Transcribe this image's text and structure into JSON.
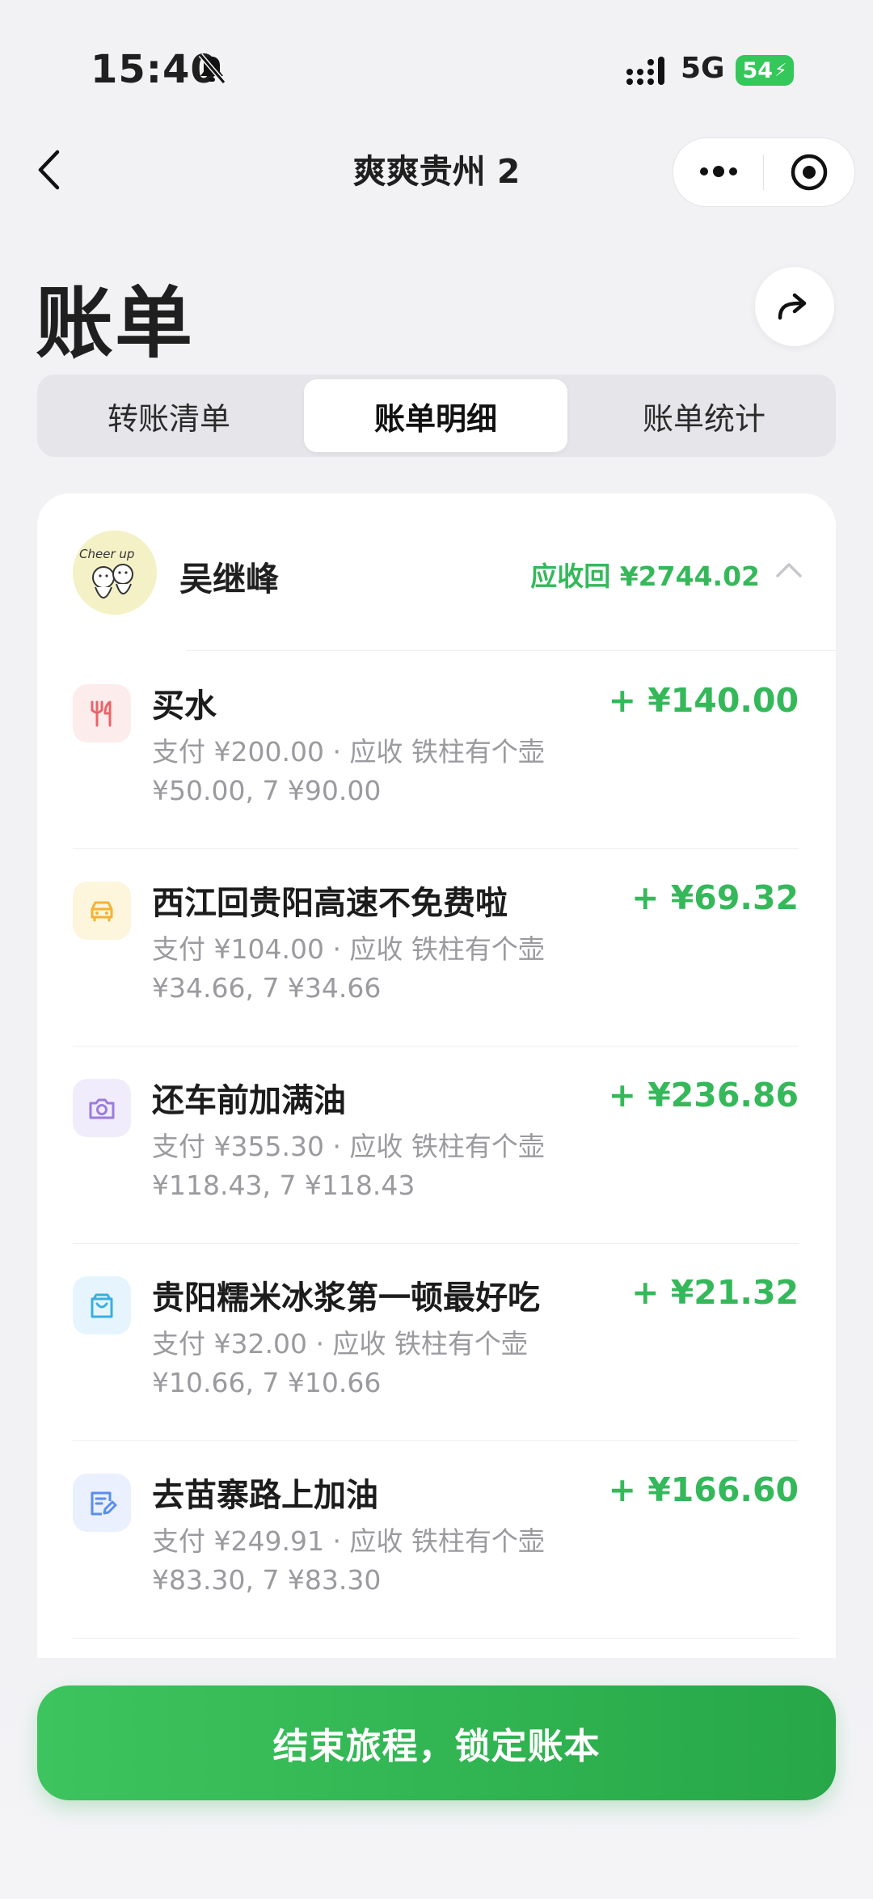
{
  "status_bar": {
    "time": "15:40",
    "network": "5G",
    "battery": "54"
  },
  "nav": {
    "title": "爽爽贵州 2"
  },
  "page": {
    "title": "账单"
  },
  "tabs": [
    {
      "label": "转账清单",
      "selected": false
    },
    {
      "label": "账单明细",
      "selected": true
    },
    {
      "label": "账单统计",
      "selected": false
    }
  ],
  "person": {
    "name": "吴继峰",
    "receivable": "应收回 ¥2744.02",
    "avatar_text": "Cheer up"
  },
  "items": [
    {
      "icon": "fork-knife-icon",
      "title": "买水",
      "sub1": "支付 ¥200.00 · 应收 铁柱有个壶",
      "sub2": "¥50.00, 7 ¥90.00",
      "amount": "+ ¥140.00"
    },
    {
      "icon": "car-icon",
      "title": "西江回贵阳高速不免费啦",
      "sub1": "支付 ¥104.00 · 应收 铁柱有个壶",
      "sub2": "¥34.66, 7 ¥34.66",
      "amount": "+ ¥69.32"
    },
    {
      "icon": "camera-icon",
      "title": "还车前加满油",
      "sub1": "支付 ¥355.30 · 应收 铁柱有个壶",
      "sub2": "¥118.43, 7 ¥118.43",
      "amount": "+ ¥236.86"
    },
    {
      "icon": "shopping-bag-icon",
      "title": "贵阳糯米冰浆第一顿最好吃",
      "sub1": "支付 ¥32.00 · 应收 铁柱有个壶",
      "sub2": "¥10.66, 7 ¥10.66",
      "amount": "+ ¥21.32"
    },
    {
      "icon": "edit-note-icon",
      "title": "去苗寨路上加油",
      "sub1": "支付 ¥249.91 · 应收 铁柱有个壶",
      "sub2": "¥83.30, 7 ¥83.30",
      "amount": "+ ¥166.60"
    }
  ],
  "cta": {
    "label": "结束旅程，锁定账本"
  },
  "colors": {
    "accent_green": "#35b85a",
    "icon_red_bg": "#fdecec",
    "icon_yellow_bg": "#fdf5dc",
    "icon_purple_bg": "#f1ecfb",
    "icon_blue_bg": "#e6f5fd",
    "icon_indigo_bg": "#eaf0fd"
  }
}
